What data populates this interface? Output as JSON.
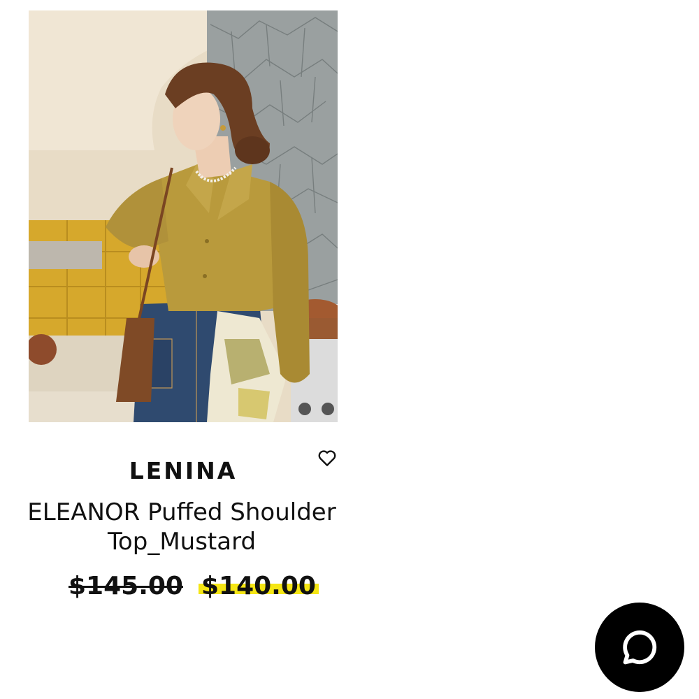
{
  "product": {
    "brand": "LENINA",
    "name": "ELEANOR Puffed Shoulder Top_Mustard",
    "price_original": "$145.00",
    "price_sale": "$140.00",
    "image_alt": "Model wearing mustard puffed shoulder top with denim skirt",
    "wishlist_icon": "heart-outline-icon"
  },
  "chat": {
    "icon": "chat-bubble-icon"
  },
  "colors": {
    "sale_highlight": "#f5e614",
    "chat_bg": "#000000",
    "text": "#111111"
  }
}
